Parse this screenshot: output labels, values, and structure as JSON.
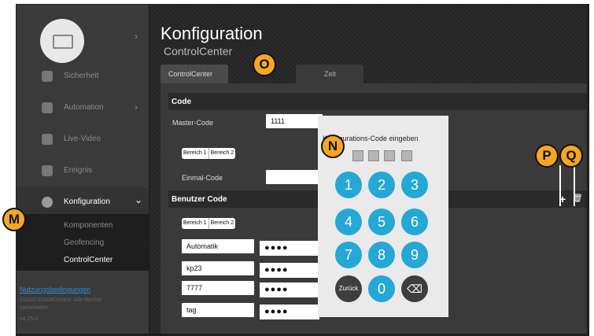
{
  "sidebar": {
    "items": [
      {
        "label": "Sicherheit",
        "icon": "shield-icon"
      },
      {
        "label": "Automation",
        "icon": "sliders-icon",
        "chevron": "›"
      },
      {
        "label": "Live-Video",
        "icon": "camera-icon"
      },
      {
        "label": "Ereignis",
        "icon": "list-icon"
      },
      {
        "label": "Konfiguration",
        "icon": "gear-icon",
        "chevron": "⌄"
      }
    ],
    "subitems": [
      "Komponenten",
      "Geofencing",
      "ControlCenter"
    ],
    "device_chevron": "›",
    "terms_link": "Nutzungsbedingungen",
    "copyright": "©2020 SSAMControl. Alle Rechte vorbehalten",
    "version": "v4.25.0"
  },
  "header": {
    "title": "Konfiguration",
    "subtitle": "ControlCenter"
  },
  "tabs": [
    "ControlCenter",
    "Zeit"
  ],
  "code_section": {
    "title": "Code",
    "master_label": "Master-Code",
    "master_value": "1111",
    "bereich1": "Bereich 1",
    "bereich2": "Bereich 2",
    "einmal_label": "Einmal-Code"
  },
  "benutzer_section": {
    "title": "Benutzer Code",
    "add_icon": "+",
    "delete_icon": "🗑",
    "bereich1": "Bereich 1",
    "bereich2": "Bereich 2",
    "rows": [
      {
        "name": "Automatik",
        "code": "●●●●"
      },
      {
        "name": "kp23",
        "code": "●●●●"
      },
      {
        "name": "7777",
        "code": "●●●●"
      },
      {
        "name": "tag",
        "code": "●●●●"
      }
    ]
  },
  "keypad": {
    "title": "Konfigurations-Code eingeben",
    "keys": [
      "1",
      "2",
      "3",
      "4",
      "5",
      "6",
      "7",
      "8",
      "9"
    ],
    "back": "Zurück",
    "zero": "0",
    "backspace": "⌫"
  },
  "markers": {
    "m": "M",
    "n": "N",
    "o": "O",
    "p": "P",
    "q": "Q"
  },
  "colors": {
    "accent": "#25a8d6",
    "marker": "#f5a623",
    "sidebar": "#3a3a3a",
    "link": "#2f8fd6"
  }
}
